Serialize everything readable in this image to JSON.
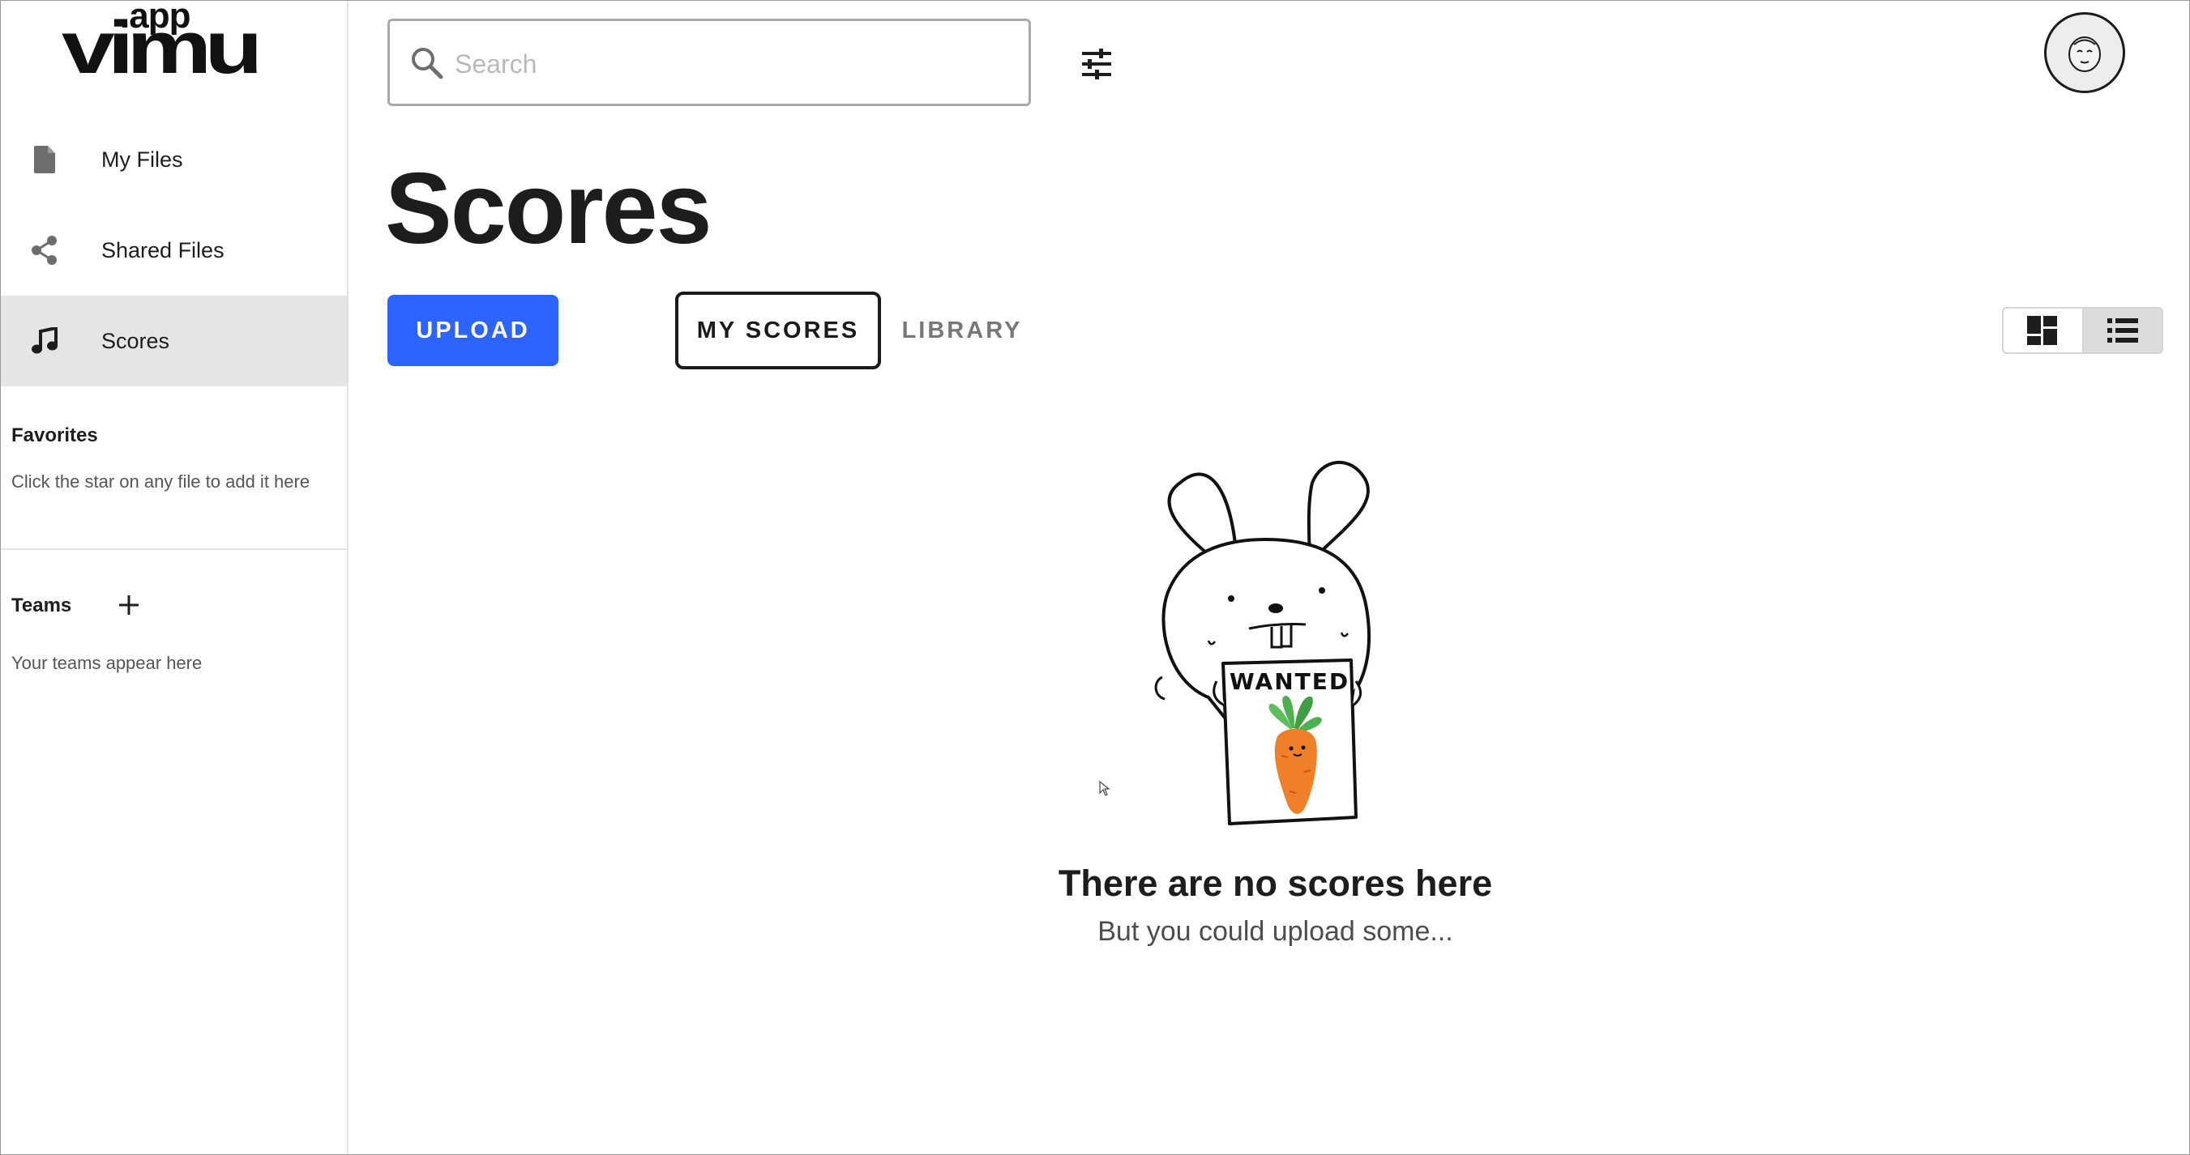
{
  "logo": {
    "tld": ".app",
    "wordmark": "vimu"
  },
  "sidebar": {
    "items": [
      {
        "label": "My Files",
        "icon": "file-icon",
        "active": false
      },
      {
        "label": "Shared Files",
        "icon": "share-icon",
        "active": false
      },
      {
        "label": "Scores",
        "icon": "music-note-icon",
        "active": true
      }
    ],
    "favorites": {
      "heading": "Favorites",
      "hint": "Click the star on any file to add it here"
    },
    "teams": {
      "heading": "Teams",
      "hint": "Your teams appear here"
    }
  },
  "header": {
    "search": {
      "placeholder": "Search",
      "value": ""
    }
  },
  "page": {
    "title": "Scores",
    "upload_label": "UPLOAD",
    "tabs": [
      {
        "label": "MY SCORES",
        "selected": true
      },
      {
        "label": "LIBRARY",
        "selected": false
      }
    ],
    "view_mode": "list"
  },
  "empty_state": {
    "sign_text": "WANTED",
    "title": "There are no scores here",
    "subtitle": "But you could upload some..."
  },
  "colors": {
    "accent": "#2d64ff",
    "active_nav_bg": "#e5e5e5",
    "text": "#1d1d1d",
    "muted_text": "#777777",
    "carrot": "#f07f2a",
    "carrot_leaves": "#4caf50"
  }
}
